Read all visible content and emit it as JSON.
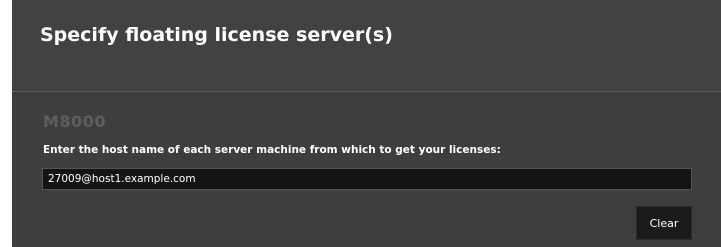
{
  "dialog": {
    "title": "Specify floating license server(s)",
    "product_name": "M8000",
    "instruction": "Enter the host name of each server machine from which to get your licenses:",
    "host_field": {
      "value": "27009@host1.example.com",
      "placeholder": ""
    },
    "clear_label": "Clear"
  },
  "colors": {
    "dialog_background": "#404040",
    "input_background": "#141414",
    "button_background": "#1b1b1b",
    "product_name_text": "#5e5e5e",
    "text": "#ffffff"
  }
}
